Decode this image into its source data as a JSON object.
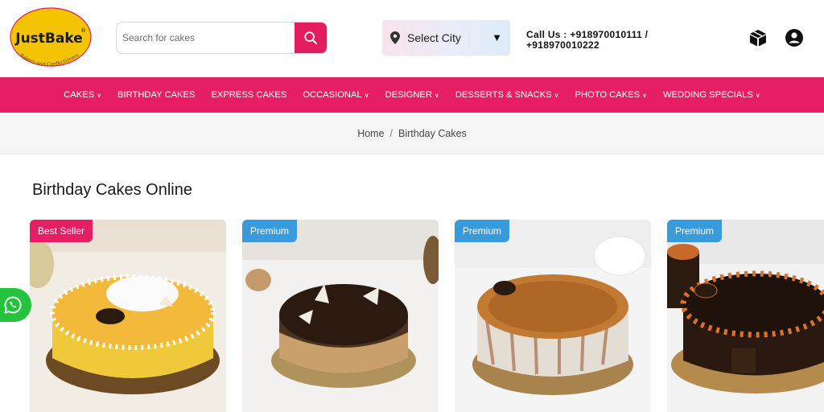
{
  "brand": {
    "logo_text": "JustBake",
    "logo_registered": "®",
    "tagline": "Bakers and Confectioners",
    "color": "#f5c400"
  },
  "search": {
    "placeholder": "Search for cakes",
    "icon": "search-icon"
  },
  "city": {
    "label": "Select City",
    "icon": "location-pin-icon",
    "caret": "▼"
  },
  "call": {
    "line1": "Call Us : +918970010111 /",
    "line2": "+918970010222"
  },
  "header_icons": [
    "box-icon",
    "user-icon"
  ],
  "nav": {
    "items": [
      {
        "label": "Cakes",
        "dropdown": true
      },
      {
        "label": "Birthday Cakes",
        "dropdown": false
      },
      {
        "label": "Express Cakes",
        "dropdown": false
      },
      {
        "label": "Occasional",
        "dropdown": true
      },
      {
        "label": "Designer",
        "dropdown": true
      },
      {
        "label": "Desserts & Snacks",
        "dropdown": true
      },
      {
        "label": "Photo Cakes",
        "dropdown": true
      },
      {
        "label": "Wedding Specials",
        "dropdown": true
      }
    ],
    "background": "#e61e63"
  },
  "breadcrumb": {
    "home": "Home",
    "separator": "/",
    "current": "Birthday Cakes"
  },
  "page_title": "Birthday Cakes Online",
  "products": [
    {
      "badge": "Best Seller",
      "badge_color": "#e61e63"
    },
    {
      "badge": "Premium",
      "badge_color": "#3a9bdc"
    },
    {
      "badge": "Premium",
      "badge_color": "#3a9bdc"
    },
    {
      "badge": "Premium",
      "badge_color": "#3a9bdc"
    }
  ],
  "floating": {
    "whatsapp_icon": "whatsapp-icon",
    "color": "#25c23d"
  }
}
